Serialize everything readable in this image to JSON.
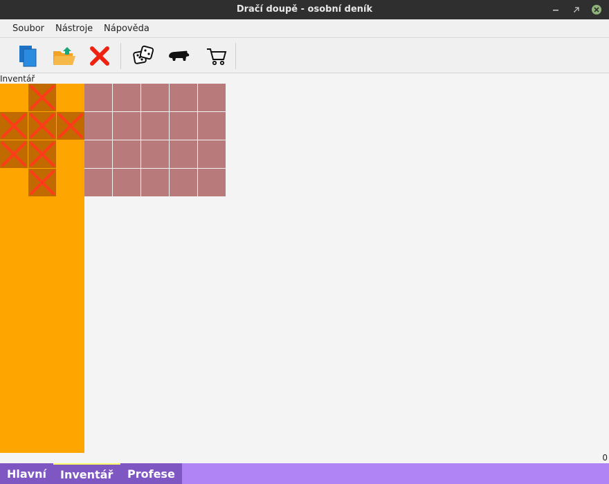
{
  "window": {
    "title": "Dračí doupě - osobní deník"
  },
  "menu": {
    "items": [
      "Soubor",
      "Nástroje",
      "Nápověda"
    ]
  },
  "toolbar": {
    "buttons": [
      "copy-icon",
      "open-folder-icon",
      "delete-icon",
      "dice-icon",
      "bear-icon",
      "cart-icon"
    ]
  },
  "inventory": {
    "label": "Inventář",
    "slot_grid": {
      "columns": 3,
      "rows": 4,
      "blocked": [
        [
          0,
          1
        ],
        [
          1,
          0
        ],
        [
          1,
          1
        ],
        [
          1,
          2
        ],
        [
          2,
          0
        ],
        [
          2,
          1
        ],
        [
          3,
          1
        ]
      ]
    },
    "storage_grid": {
      "columns": 5,
      "rows": 4
    },
    "counter": "0"
  },
  "tabs": [
    "Hlavní",
    "Inventář",
    "Profese"
  ],
  "colors": {
    "slot_background": "#ffa500",
    "blocked_slot": "#c06a00",
    "storage_cell": "#b87a7a",
    "tab_bar": "#b084f5",
    "tab": "#7e57c2",
    "active_tab_accent": "#ffff66"
  }
}
